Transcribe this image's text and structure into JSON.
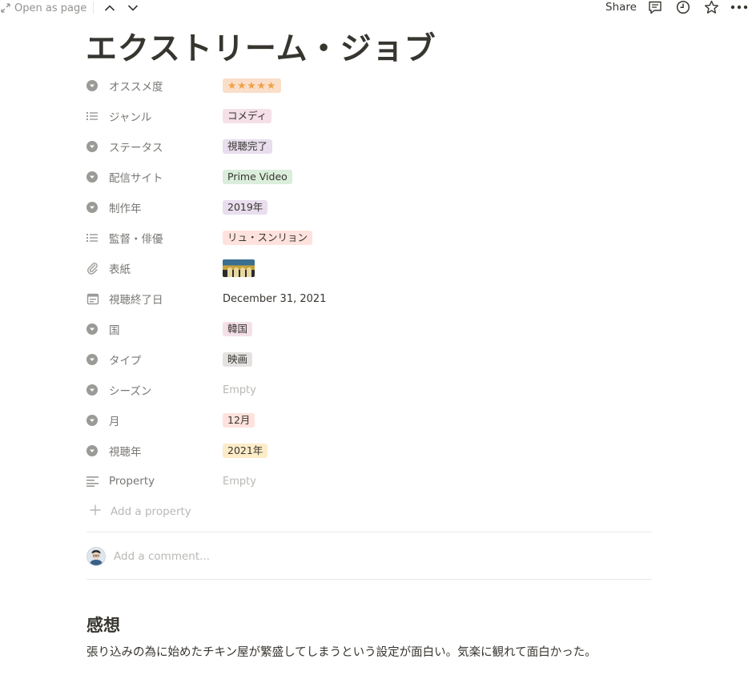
{
  "topbar": {
    "open_as_page": "Open as page",
    "share": "Share"
  },
  "page": {
    "title": "エクストリーム・ジョブ"
  },
  "properties": [
    {
      "name": "オススメ度",
      "type": "select",
      "icon": "select-icon",
      "value": "★★★★★",
      "tag_color": "#fadec9"
    },
    {
      "name": "ジャンル",
      "type": "multi_select",
      "icon": "list-icon",
      "value": "コメディ",
      "tag_color": "#f5e0e9"
    },
    {
      "name": "ステータス",
      "type": "select",
      "icon": "select-icon",
      "value": "視聴完了",
      "tag_color": "#e8deee"
    },
    {
      "name": "配信サイト",
      "type": "select",
      "icon": "select-icon",
      "value": "Prime Video",
      "tag_color": "#dbeddb"
    },
    {
      "name": "制作年",
      "type": "select",
      "icon": "select-icon",
      "value": "2019年",
      "tag_color": "#e8deee"
    },
    {
      "name": "監督・俳優",
      "type": "multi_select",
      "icon": "list-icon",
      "value": "リュ・スンリョン",
      "tag_color": "#ffe2dd"
    },
    {
      "name": "表紙",
      "type": "files",
      "icon": "paperclip-icon",
      "value": ""
    },
    {
      "name": "視聴終了日",
      "type": "date",
      "icon": "calendar-icon",
      "value": "December 31, 2021"
    },
    {
      "name": "国",
      "type": "select",
      "icon": "select-icon",
      "value": "韓国",
      "tag_color": "#f5e0e9"
    },
    {
      "name": "タイプ",
      "type": "select",
      "icon": "select-icon",
      "value": "映画",
      "tag_color": "#e3e2e0"
    },
    {
      "name": "シーズン",
      "type": "select",
      "icon": "select-icon",
      "value": "Empty",
      "empty": true
    },
    {
      "name": "月",
      "type": "select",
      "icon": "select-icon",
      "value": "12月",
      "tag_color": "#ffe2dd"
    },
    {
      "name": "視聴年",
      "type": "select",
      "icon": "select-icon",
      "value": "2021年",
      "tag_color": "#fdecc8"
    },
    {
      "name": "Property",
      "type": "text",
      "icon": "text-icon",
      "value": "Empty",
      "empty": true
    }
  ],
  "add_property": "Add a property",
  "comment": {
    "placeholder": "Add a comment..."
  },
  "content": {
    "heading": "感想",
    "paragraph": "張り込みの為に始めたチキン屋が繁盛してしまうという設定が面白い。気楽に観れて面白かった。"
  }
}
